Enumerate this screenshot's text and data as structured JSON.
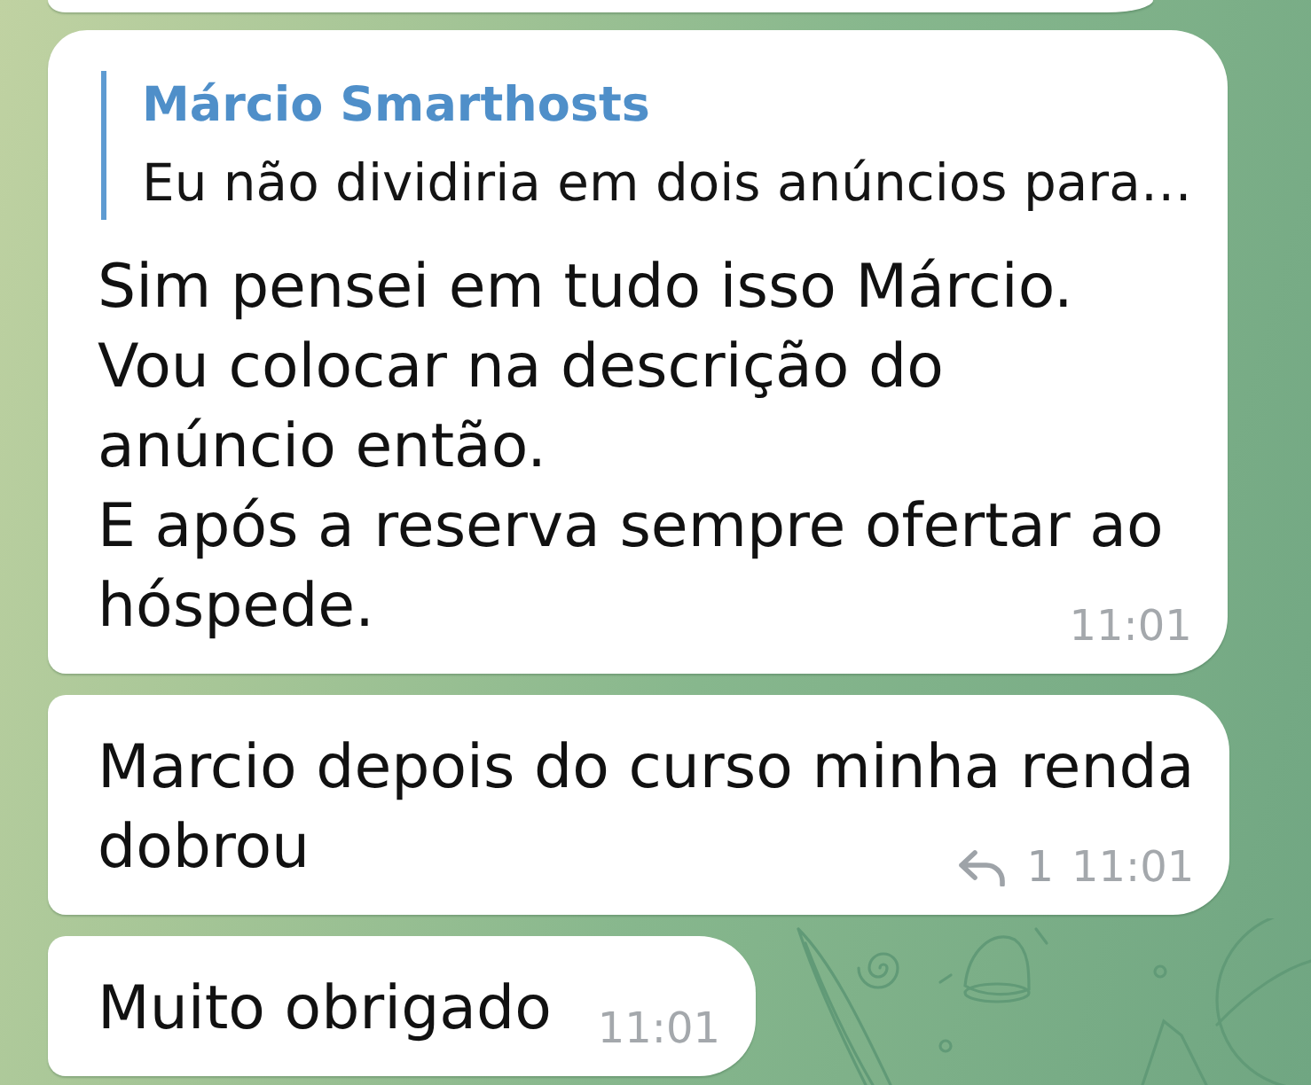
{
  "messages": [
    {
      "kind": "cut_off"
    },
    {
      "kind": "message",
      "quote": {
        "author": "Márcio Smarthosts",
        "text": "Eu não dividiria em dois anúncios para…"
      },
      "lines": [
        "Sim pensei em tudo isso Márcio.",
        "Vou colocar na descrição do",
        "anúncio então.",
        "E após a reserva sempre ofertar ao",
        "hóspede."
      ],
      "time": "11:01"
    },
    {
      "kind": "message",
      "lines": [
        "Marcio depois do curso minha renda",
        "dobrou"
      ],
      "replies": "1",
      "time": "11:01"
    },
    {
      "kind": "message",
      "lines": [
        "Muito obrigado"
      ],
      "time": "11:01"
    }
  ]
}
